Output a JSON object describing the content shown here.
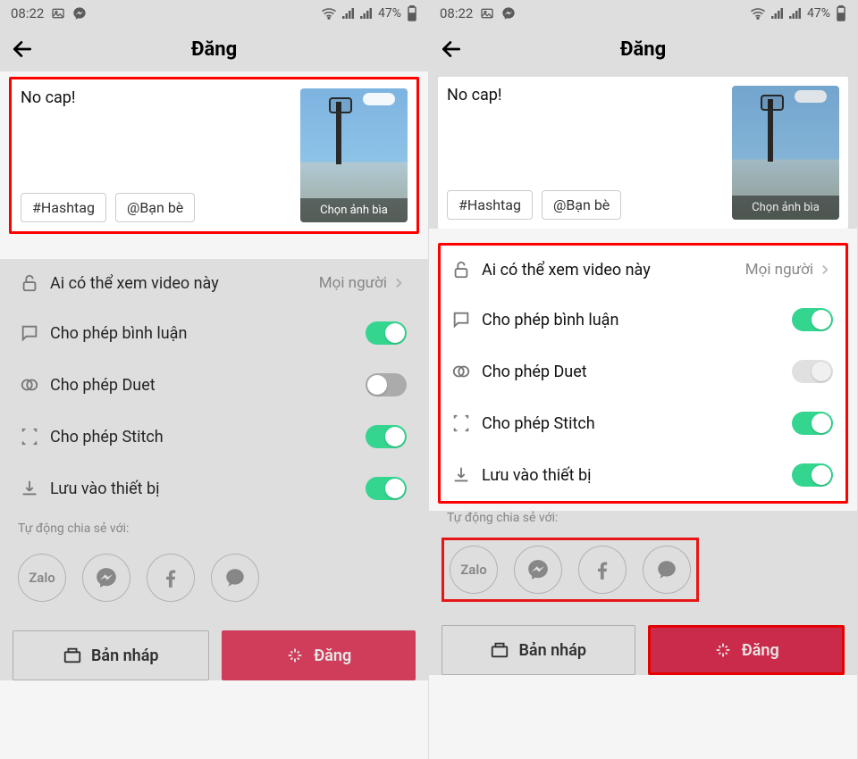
{
  "status": {
    "time": "08:22",
    "battery": "47%"
  },
  "header": {
    "title": "Đăng"
  },
  "caption": {
    "text": "No cap!",
    "hashtag_chip": "#Hashtag",
    "mention_chip": "@Bạn bè",
    "cover_label": "Chọn ảnh bìa"
  },
  "settings": {
    "privacy": {
      "label": "Ai có thể xem video này",
      "value": "Mọi người"
    },
    "comments": {
      "label": "Cho phép bình luận",
      "on": true
    },
    "duet": {
      "label": "Cho phép Duet",
      "on": false
    },
    "stitch": {
      "label": "Cho phép Stitch",
      "on": true
    },
    "save": {
      "label": "Lưu vào thiết bị",
      "on": true
    }
  },
  "share": {
    "label": "Tự động chia sẻ với:",
    "zalo": "Zalo"
  },
  "buttons": {
    "draft": "Bản nháp",
    "post": "Đăng"
  }
}
